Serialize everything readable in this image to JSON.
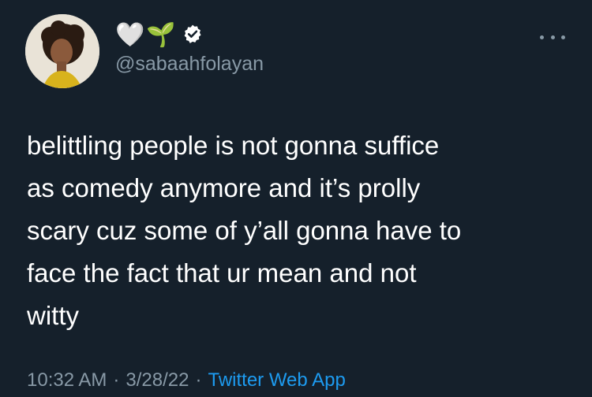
{
  "user": {
    "display_name": "🤍🌱",
    "handle": "@sabaahfolayan",
    "verified": true
  },
  "tweet": {
    "text": "belittling people is not gonna suffice\nas comedy anymore and it’s prolly\nscary cuz some of y’all gonna have to\nface the fact that ur mean and not\nwitty"
  },
  "meta": {
    "time": "10:32 AM",
    "sep1": "·",
    "date": "3/28/22",
    "sep2": "·",
    "source": "Twitter Web App"
  },
  "colors": {
    "background": "#15202b",
    "text": "#ffffff",
    "secondary": "#8899a6",
    "link": "#1d9bf0",
    "verified_badge": "#ffffff"
  },
  "icons": {
    "more": "more-horizontal-icon",
    "verified": "verified-badge-icon"
  }
}
